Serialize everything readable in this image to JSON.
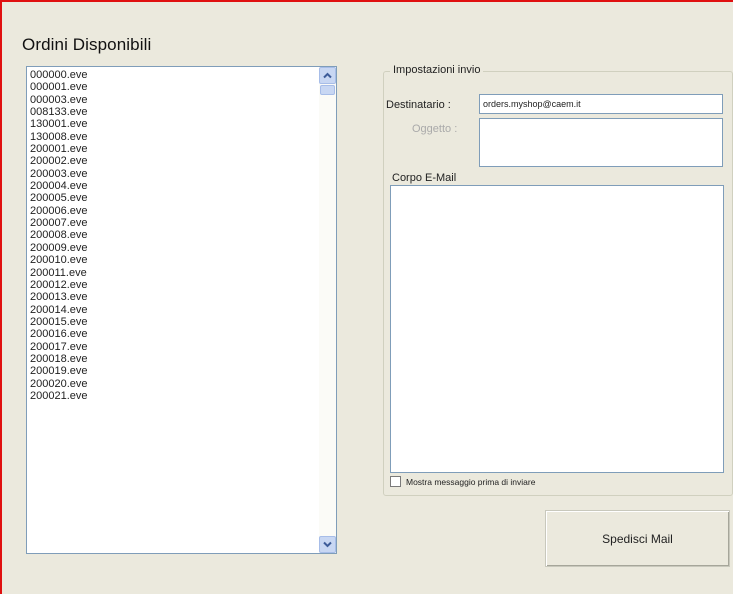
{
  "orders_panel": {
    "title": "Ordini Disponibili",
    "files": [
      "000000.eve",
      "000001.eve",
      "000003.eve",
      "008133.eve",
      "130001.eve",
      "130008.eve",
      "200001.eve",
      "200002.eve",
      "200003.eve",
      "200004.eve",
      "200005.eve",
      "200006.eve",
      "200007.eve",
      "200008.eve",
      "200009.eve",
      "200010.eve",
      "200011.eve",
      "200012.eve",
      "200013.eve",
      "200014.eve",
      "200015.eve",
      "200016.eve",
      "200017.eve",
      "200018.eve",
      "200019.eve",
      "200020.eve",
      "200021.eve"
    ]
  },
  "send_settings": {
    "group_title": "Impostazioni invio",
    "recipient_label": "Destinatario :",
    "recipient_value": "orders.myshop@caem.it",
    "subject_label": "Oggetto :",
    "subject_value": "",
    "body_label": "Corpo E-Mail",
    "body_value": "",
    "preview_checkbox_label": "Mostra messaggio prima di inviare",
    "preview_checked": false
  },
  "actions": {
    "send_label": "Spedisci Mail"
  },
  "colors": {
    "window_border": "#e01010",
    "background": "#ebe9dd",
    "input_border": "#7f9db9"
  },
  "icons": {
    "scroll_up": "chevron-up-icon",
    "scroll_down": "chevron-down-icon"
  }
}
